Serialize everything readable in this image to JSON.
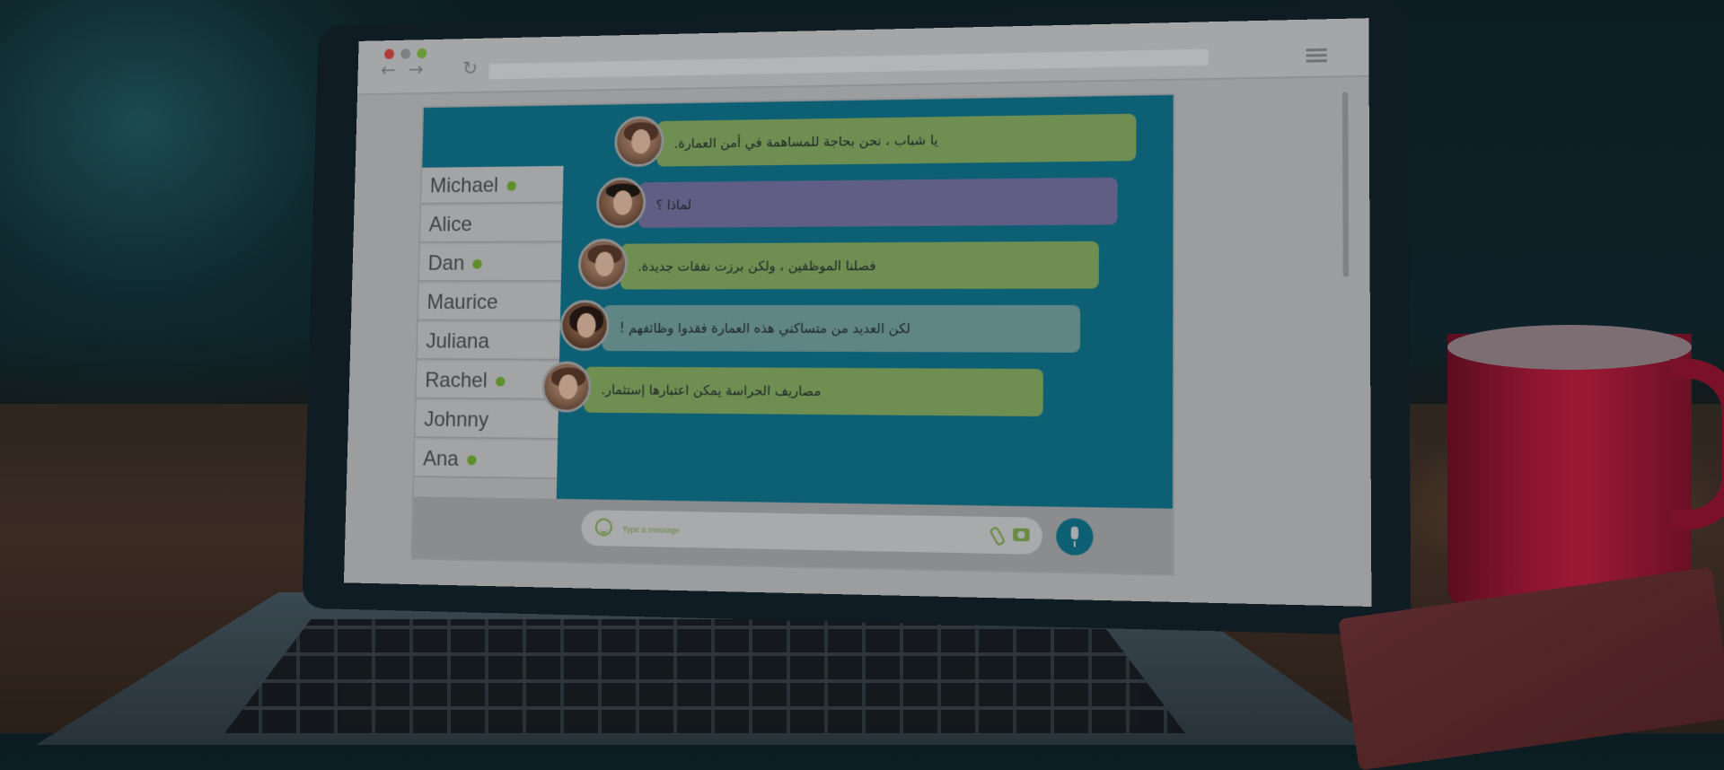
{
  "browser": {
    "back_icon": "arrow-left-icon",
    "forward_icon": "arrow-right-icon",
    "reload_icon": "reload-icon",
    "menu_icon": "hamburger-menu-icon"
  },
  "contacts": [
    {
      "name": "Michael",
      "online": true
    },
    {
      "name": "Alice",
      "online": false
    },
    {
      "name": "Dan",
      "online": true
    },
    {
      "name": "Maurice",
      "online": false
    },
    {
      "name": "Juliana",
      "online": false
    },
    {
      "name": "Rachel",
      "online": true
    },
    {
      "name": "Johnny",
      "online": false
    },
    {
      "name": "Ana",
      "online": true
    }
  ],
  "messages": [
    {
      "text": "يا شباب ، نحن بحاجة للمساهمة في أمن العمارة.",
      "color": "#6f8e52"
    },
    {
      "text": "لماذا ؟",
      "color": "#615e86"
    },
    {
      "text": "فصلنا الموظفين ، ولكن برزت نفقات جديدة.",
      "color": "#6f8e52"
    },
    {
      "text": "لكن العديد من متساكني هذه العمارة فقدوا وظائفهم !",
      "color": "#5f8585"
    },
    {
      "text": "مصاريف الحراسة يمكن اعتبارها إستثمار.",
      "color": "#6f8e52"
    }
  ],
  "composer": {
    "placeholder": "Type a message",
    "emoji_icon": "smiley-icon",
    "attach_icon": "paperclip-icon",
    "camera_icon": "camera-icon",
    "mic_icon": "microphone-icon"
  },
  "colors": {
    "header": "#0d5f74",
    "online_dot": "#5e8f2b",
    "bubble_green": "#6f8e52",
    "bubble_purple": "#615e86",
    "bubble_teal": "#5f8585"
  }
}
